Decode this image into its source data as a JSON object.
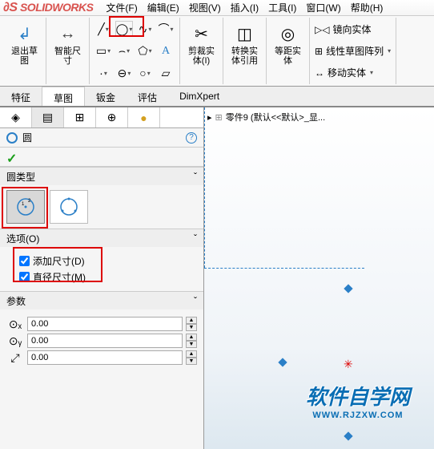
{
  "app": {
    "brand": "SOLIDWORKS"
  },
  "menu": {
    "file": "文件(F)",
    "edit": "编辑(E)",
    "view": "视图(V)",
    "insert": "插入(I)",
    "tools": "工具(I)",
    "window": "窗口(W)",
    "help": "帮助(H)"
  },
  "ribbon": {
    "exit_sketch": "退出草\n图",
    "smart_dim": "智能尺\n寸",
    "trim": "剪裁实\n体(I)",
    "convert": "转换实\n体引用",
    "offset": "等距实\n体",
    "mirror": "镜向实体",
    "pattern": "线性草图阵列",
    "move": "移动实体"
  },
  "tabs": {
    "feature": "特征",
    "sketch": "草图",
    "sheetmetal": "钣金",
    "evaluate": "评估",
    "dimxpert": "DimXpert"
  },
  "tree": {
    "part": "零件9 (默认<<默认>_显..."
  },
  "panel": {
    "title": "圆",
    "sec_type": "圆类型",
    "sec_options": "选项(O)",
    "opt_add_dim": "添加尺寸(D)",
    "opt_dia_dim": "直径尺寸(M)",
    "sec_params": "参数",
    "val_x": "0.00",
    "val_y": "0.00",
    "val_r": "0.00"
  },
  "watermark": {
    "line1": "软件自学网",
    "line2": "WWW.RJZXW.COM"
  },
  "glyph": {
    "help": "?",
    "expand": "ˇ",
    "tri": "▸",
    "up": "▲",
    "down": "▼"
  }
}
